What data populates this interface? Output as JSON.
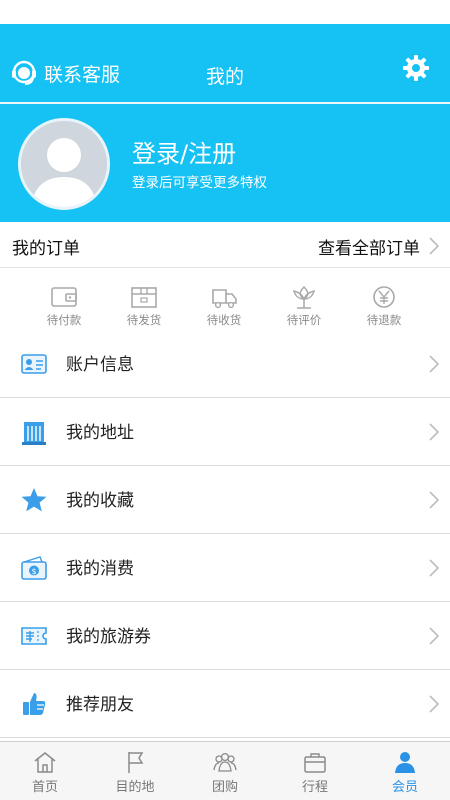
{
  "header": {
    "customer_service_label": "联系客服",
    "title": "我的"
  },
  "profile": {
    "login_title": "登录/注册",
    "login_subtitle": "登录后可享受更多特权"
  },
  "orders": {
    "title": "我的订单",
    "view_all": "查看全部订单",
    "statuses": [
      {
        "label": "待付款",
        "icon": "wallet-icon"
      },
      {
        "label": "待发货",
        "icon": "package-icon"
      },
      {
        "label": "待收货",
        "icon": "delivery-truck-icon"
      },
      {
        "label": "待评价",
        "icon": "flower-icon"
      },
      {
        "label": "待退款",
        "icon": "refund-icon"
      }
    ]
  },
  "menu": {
    "items": [
      {
        "label": "账户信息",
        "icon": "id-card-icon"
      },
      {
        "label": "我的地址",
        "icon": "building-icon"
      },
      {
        "label": "我的收藏",
        "icon": "star-icon"
      },
      {
        "label": "我的消费",
        "icon": "money-icon"
      },
      {
        "label": "我的旅游券",
        "icon": "coupon-icon"
      },
      {
        "label": "推荐朋友",
        "icon": "thumbs-up-icon"
      }
    ]
  },
  "tabbar": {
    "items": [
      {
        "label": "首页",
        "icon": "home-icon"
      },
      {
        "label": "目的地",
        "icon": "flag-icon"
      },
      {
        "label": "团购",
        "icon": "group-icon"
      },
      {
        "label": "行程",
        "icon": "suitcase-icon"
      },
      {
        "label": "会员",
        "icon": "person-icon"
      }
    ],
    "active_index": 4
  },
  "colors": {
    "accent": "#16c1f3",
    "tab_active": "#2a92e6",
    "icon_blue": "#3a9ee8"
  }
}
